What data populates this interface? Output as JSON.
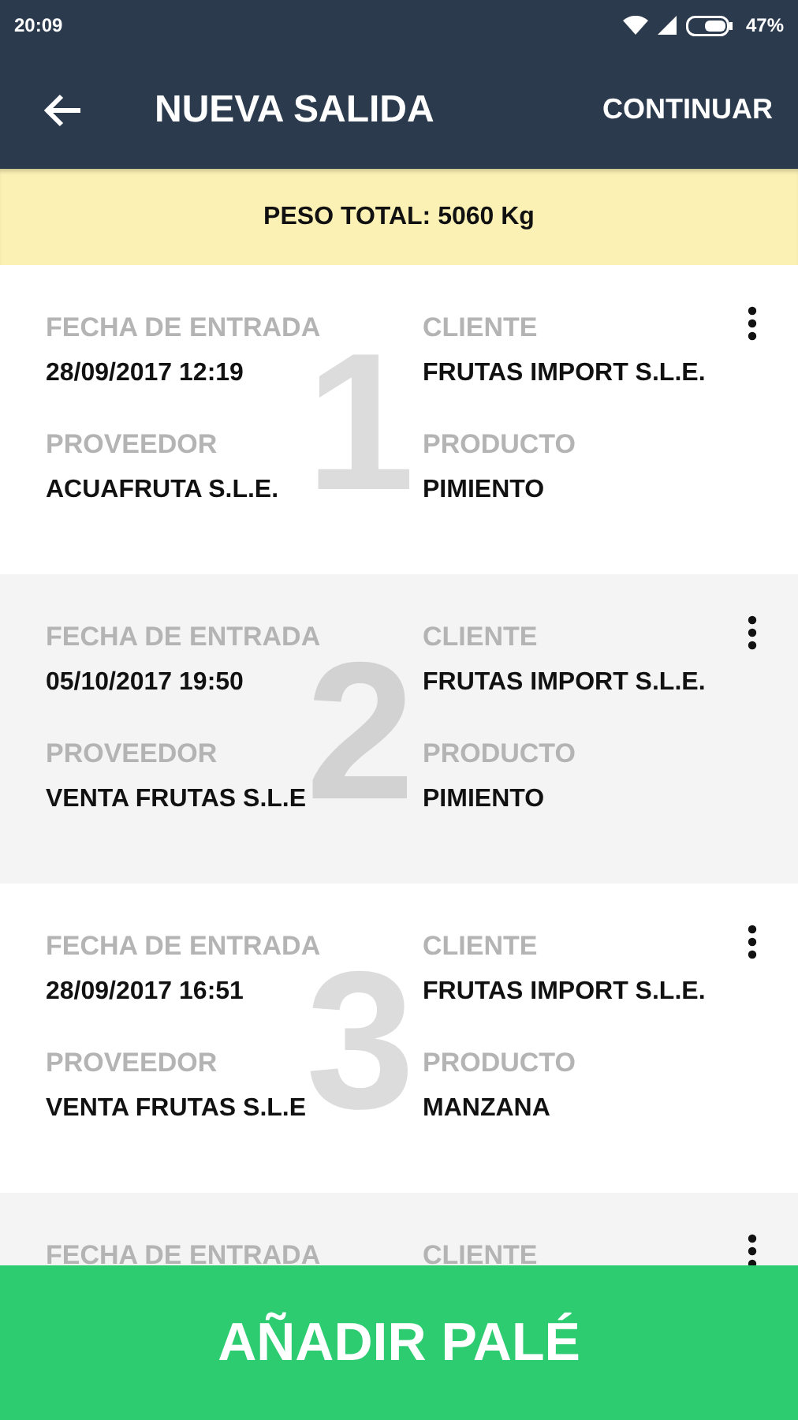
{
  "status_bar": {
    "time": "20:09",
    "battery": "47%"
  },
  "toolbar": {
    "title": "NUEVA SALIDA",
    "action": "CONTINUAR"
  },
  "summary": {
    "text": "PESO TOTAL: 5060 Kg"
  },
  "entries": [
    {
      "index": "1",
      "fields": [
        {
          "label": "FECHA DE ENTRADA",
          "value": "28/09/2017 12:19"
        },
        {
          "label": "CLIENTE",
          "value": "FRUTAS IMPORT S.L.E."
        },
        {
          "label": "PROVEEDOR",
          "value": "ACUAFRUTA S.L.E."
        },
        {
          "label": "PRODUCTO",
          "value": "PIMIENTO"
        }
      ]
    },
    {
      "index": "2",
      "fields": [
        {
          "label": "FECHA DE ENTRADA",
          "value": "05/10/2017 19:50"
        },
        {
          "label": "CLIENTE",
          "value": "FRUTAS IMPORT S.L.E."
        },
        {
          "label": "PROVEEDOR",
          "value": "VENTA FRUTAS S.L.E"
        },
        {
          "label": "PRODUCTO",
          "value": "PIMIENTO"
        }
      ]
    },
    {
      "index": "3",
      "fields": [
        {
          "label": "FECHA DE ENTRADA",
          "value": "28/09/2017 16:51"
        },
        {
          "label": "CLIENTE",
          "value": "FRUTAS IMPORT S.L.E."
        },
        {
          "label": "PROVEEDOR",
          "value": "VENTA FRUTAS S.L.E"
        },
        {
          "label": "PRODUCTO",
          "value": "MANZANA"
        }
      ]
    },
    {
      "fields": [
        {
          "label": "FECHA DE ENTRADA"
        },
        {
          "label": "CLIENTE"
        }
      ]
    }
  ],
  "primary_button": {
    "label": "AÑADIR PALÉ"
  }
}
